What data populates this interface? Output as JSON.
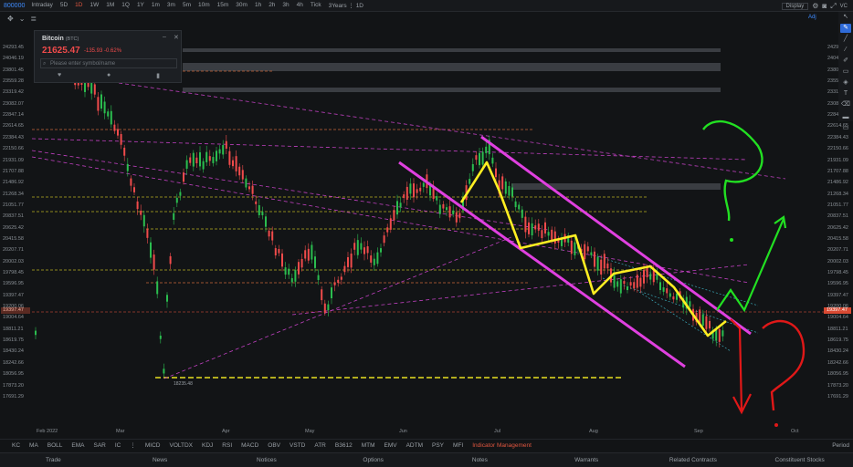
{
  "toolbar": {
    "symbol": "800000",
    "periods": [
      "Intraday",
      "5D",
      "1D",
      "1W",
      "1M",
      "1Q",
      "1Y",
      "1m",
      "3m",
      "5m",
      "10m",
      "15m",
      "30m",
      "1h",
      "2h",
      "3h",
      "4h",
      "Tick",
      "3Years ⋮ 1D"
    ],
    "active_period": "1D",
    "display": "Display",
    "right_code": "VC"
  },
  "subbar": {
    "adj": "Adj"
  },
  "quote": {
    "name": "Bitcoin",
    "code": "(BTC)",
    "price": "21625.47",
    "change": "-135.93  -0.62%",
    "search_placeholder": "Please enter symbol/name"
  },
  "yaxis_labels": [
    "24293.45",
    "24046.19",
    "23801.45",
    "23559.28",
    "23319.42",
    "23082.07",
    "22847.14",
    "22614.65",
    "22384.43",
    "22150.66",
    "21931.09",
    "21707.88",
    "21486.92",
    "21268.34",
    "21051.77",
    "20837.51",
    "20625.42",
    "20415.58",
    "20207.71",
    "20002.03",
    "19798.45",
    "19596.95",
    "19397.47",
    "19200.06",
    "19004.64",
    "18811.21",
    "18619.75",
    "18430.24",
    "18242.66",
    "18056.95",
    "17873.20",
    "17691.29"
  ],
  "left_labels": [
    "24293.45",
    "24046.19",
    "23801.45",
    "23559.28",
    "23319.42",
    "23082.07",
    "22847.14",
    "22614.65",
    "22384.43",
    "22150.66",
    "21931.09",
    "21707.88",
    "21486.92",
    "21268.34",
    "21051.77",
    "20837.51",
    "20625.42",
    "20415.58",
    "20207.71",
    "20002.03",
    "19798.45",
    "19596.95",
    "19397.47",
    "19200.06",
    "19004.64",
    "18811.21",
    "18619.75",
    "18430.24",
    "18242.66",
    "18056.95",
    "17873.20",
    "17691.29"
  ],
  "current_price_tag": "19397.47",
  "low_label": "18235.48",
  "xaxis_labels": [
    "Feb 2022",
    "Mar",
    "Apr",
    "May",
    "Jun",
    "Jul",
    "Aug",
    "Sep",
    "Oct"
  ],
  "indicators": [
    "KC",
    "MA",
    "BOLL",
    "EMA",
    "SAR",
    "IC",
    "⋮",
    "MICD",
    "VOLTDX",
    "KDJ",
    "RSI",
    "MACD",
    "OBV",
    "VSTD",
    "ATR",
    "B3612",
    "MTM",
    "EMV",
    "ADTM",
    "PSY",
    "MFI"
  ],
  "indicator_mgmt": "Indicator Management",
  "period_label": "Period",
  "bottom_tabs": [
    "Trade",
    "News",
    "Notices",
    "Options",
    "Notes",
    "Warrants",
    "Related Contracts",
    "Constituent Stocks"
  ],
  "colors": {
    "up": "#2bbd4f",
    "down": "#f04b4b",
    "accent": "#e0563f",
    "magenta": "#e040e0",
    "yellow": "#ffee22"
  }
}
